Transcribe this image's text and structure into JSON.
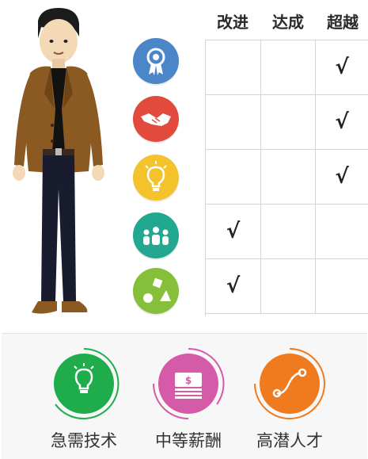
{
  "table": {
    "headers": [
      "改进",
      "达成",
      "超越"
    ],
    "rows": [
      {
        "icon": "award-ribbon-icon",
        "color": "#4a86c8",
        "marks": [
          "",
          "",
          "√"
        ]
      },
      {
        "icon": "handshake-icon",
        "color": "#e14a3c",
        "marks": [
          "",
          "",
          "√"
        ]
      },
      {
        "icon": "lightbulb-icon",
        "color": "#f4c22b",
        "marks": [
          "",
          "",
          "√"
        ]
      },
      {
        "icon": "team-icon",
        "color": "#22a891",
        "marks": [
          "√",
          "",
          ""
        ]
      },
      {
        "icon": "shapes-icon",
        "color": "#86bf3a",
        "marks": [
          "√",
          "",
          ""
        ]
      }
    ]
  },
  "categories": [
    {
      "label": "急需技术",
      "icon": "lightbulb-icon",
      "color": "#1fad4c"
    },
    {
      "label": "中等薪酬",
      "icon": "money-stack-icon",
      "color": "#d55aa7"
    },
    {
      "label": "高潜人才",
      "icon": "growth-curve-icon",
      "color": "#f07b1f"
    }
  ]
}
